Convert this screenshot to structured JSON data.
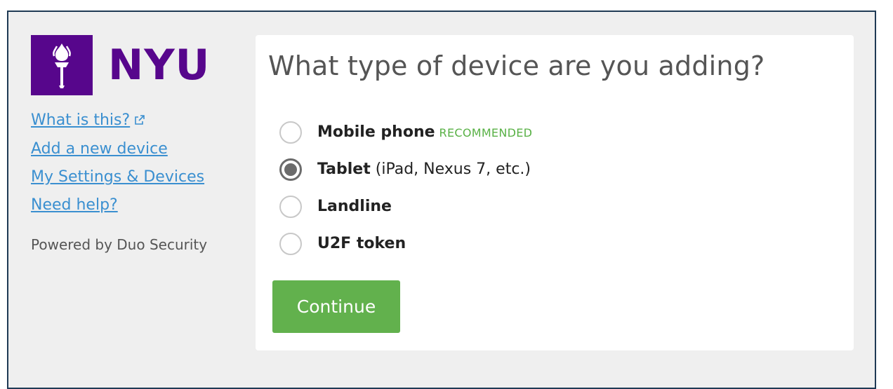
{
  "brand": {
    "logo_text": "NYU",
    "logo_icon": "torch-icon",
    "color": "#57068c"
  },
  "sidebar": {
    "links": [
      {
        "label": "What is this?",
        "icon": "external-link-icon"
      },
      {
        "label": "Add a new device"
      },
      {
        "label": "My Settings & Devices"
      },
      {
        "label": "Need help?"
      }
    ],
    "powered_by": "Powered by Duo Security"
  },
  "main": {
    "title": "What type of device are you adding?",
    "options": [
      {
        "label": "Mobile phone",
        "badge": "RECOMMENDED",
        "note": "",
        "selected": false
      },
      {
        "label": "Tablet",
        "badge": "",
        "note": "(iPad, Nexus 7, etc.)",
        "selected": true
      },
      {
        "label": "Landline",
        "badge": "",
        "note": "",
        "selected": false
      },
      {
        "label": "U2F token",
        "badge": "",
        "note": "",
        "selected": false
      }
    ],
    "continue_label": "Continue"
  },
  "colors": {
    "accent_green": "#62b14d",
    "link_blue": "#3a8fd0",
    "recommended_green": "#59b146"
  }
}
